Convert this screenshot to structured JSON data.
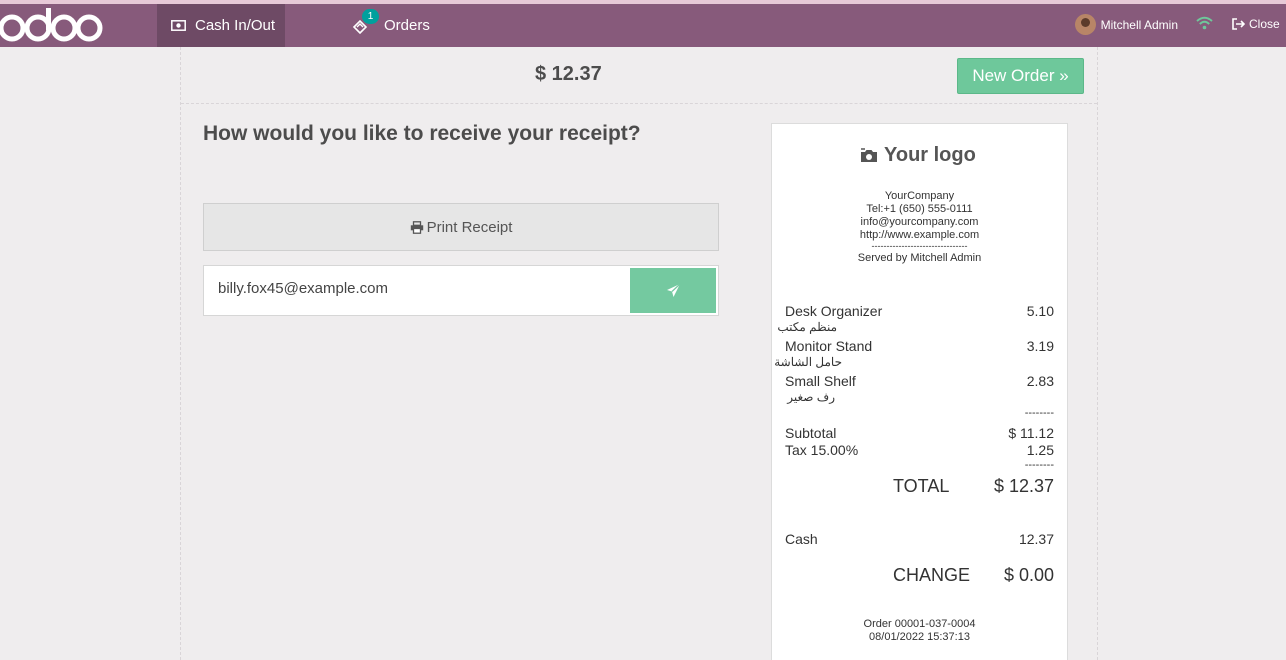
{
  "brand": {
    "logo_text": "odoo"
  },
  "navbar": {
    "cash_label": "Cash In/Out",
    "orders_label": "Orders",
    "orders_badge": "1",
    "user_name": "Mitchell Admin",
    "close_label": "Close"
  },
  "payment": {
    "total": "$ 12.37",
    "new_order_label": "New Order »",
    "question": "How would you like to receive your receipt?",
    "print_label": "Print Receipt",
    "email_value": "billy.fox45@example.com"
  },
  "receipt": {
    "logo_text": "Your logo",
    "company": "YourCompany",
    "phone": "Tel:+1 (650) 555-0111",
    "email": "info@yourcompany.com",
    "website": "http://www.example.com",
    "separator": "--------------------------------",
    "served_by": "Served by Mitchell Admin",
    "lines": [
      {
        "name": "Desk Organizer",
        "arabic": "منظم مكتب",
        "price": "5.10"
      },
      {
        "name": "Monitor Stand",
        "arabic": "حامل الشاشة",
        "price": "3.19"
      },
      {
        "name": "Small Shelf",
        "arabic": "رف صغير",
        "price": "2.83"
      }
    ],
    "dash": "--------",
    "subtotal_label": "Subtotal",
    "subtotal_value": "$ 11.12",
    "tax_label": "Tax 15.00%",
    "tax_value": "1.25",
    "total_label": "TOTAL",
    "total_value": "$ 12.37",
    "cash_label": "Cash",
    "cash_value": "12.37",
    "change_label": "CHANGE",
    "change_value": "$ 0.00",
    "order_ref": "Order 00001-037-0004",
    "order_date": "08/01/2022 15:37:13"
  },
  "colors": {
    "navbar": "#875a7b",
    "accent": "#6ec89b",
    "badge": "#00a09d"
  }
}
